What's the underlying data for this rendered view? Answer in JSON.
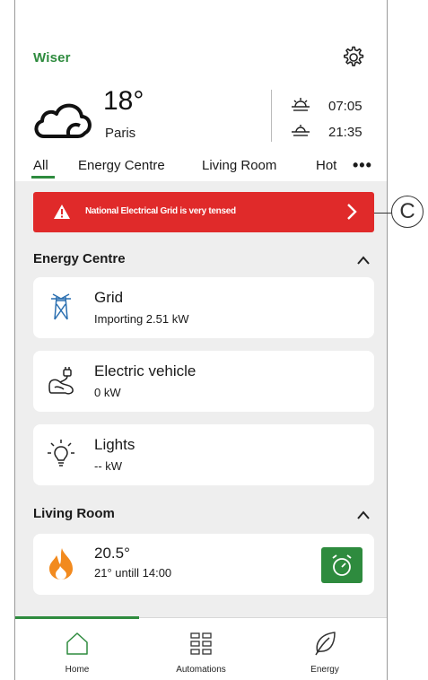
{
  "header": {
    "logo": "Wiser",
    "weather": {
      "temperature": "18°",
      "city": "Paris",
      "icon": "cloud-icon"
    },
    "sun": {
      "sunrise": "07:05",
      "sunset": "21:35"
    }
  },
  "tabs": [
    {
      "label": "All",
      "active": true
    },
    {
      "label": "Energy Centre"
    },
    {
      "label": "Living Room"
    },
    {
      "label": "Hot"
    }
  ],
  "tabs_more": "•••",
  "alert": {
    "text": "National Electrical Grid is very tensed",
    "color": "#e02a2a"
  },
  "sections": {
    "energy": {
      "title": "Energy Centre",
      "cards": [
        {
          "title": "Grid",
          "subtitle": "Importing 2.51 kW",
          "icon": "power-pylon-icon"
        },
        {
          "title": "Electric vehicle",
          "subtitle": "0 kW",
          "icon": "ev-plug-icon"
        },
        {
          "title": "Lights",
          "subtitle": "-- kW",
          "icon": "lightbulb-icon"
        }
      ]
    },
    "living": {
      "title": "Living Room",
      "cards": [
        {
          "title": "20.5°",
          "subtitle": "21° untill 14:00",
          "icon": "flame-icon"
        }
      ]
    }
  },
  "nav": [
    {
      "label": "Home",
      "icon": "home-icon",
      "active": true
    },
    {
      "label": "Automations",
      "icon": "grid-icon"
    },
    {
      "label": "Energy",
      "icon": "leaf-icon"
    }
  ],
  "callout": "C",
  "colors": {
    "accent": "#2e8b3e",
    "alert": "#e02a2a",
    "flame": "#f28a1e"
  }
}
